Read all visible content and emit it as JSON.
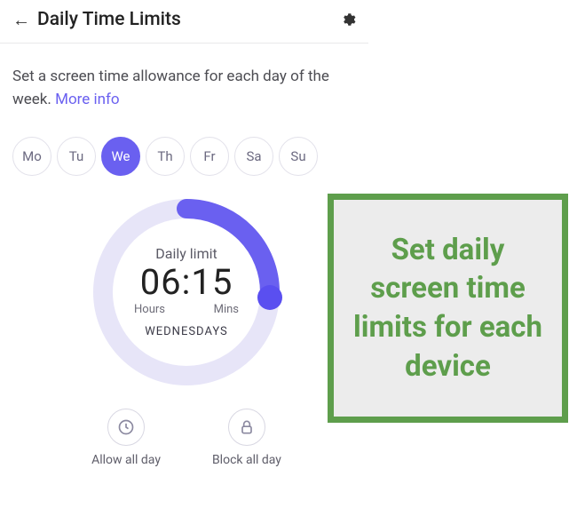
{
  "header": {
    "title": "Daily Time Limits"
  },
  "description": {
    "text": "Set a screen time allowance for each day of the week. ",
    "more_label": "More info"
  },
  "days": [
    {
      "code": "Mo",
      "active": false
    },
    {
      "code": "Tu",
      "active": false
    },
    {
      "code": "We",
      "active": true
    },
    {
      "code": "Th",
      "active": false
    },
    {
      "code": "Fr",
      "active": false
    },
    {
      "code": "Sa",
      "active": false
    },
    {
      "code": "Su",
      "active": false
    }
  ],
  "gauge": {
    "label": "Daily limit",
    "time_display": "06:15",
    "hours_unit": "Hours",
    "mins_unit": "Mins",
    "day_caps": "WEDNESDAYS",
    "fraction": 0.26,
    "track_color": "#e7e5f8",
    "fill_color": "#6a60f0"
  },
  "actions": {
    "allow": {
      "label": "Allow all day"
    },
    "block": {
      "label": "Block all day"
    }
  },
  "callout": {
    "text": "Set daily screen time limits for each device",
    "border_color": "#5e9e4c"
  }
}
